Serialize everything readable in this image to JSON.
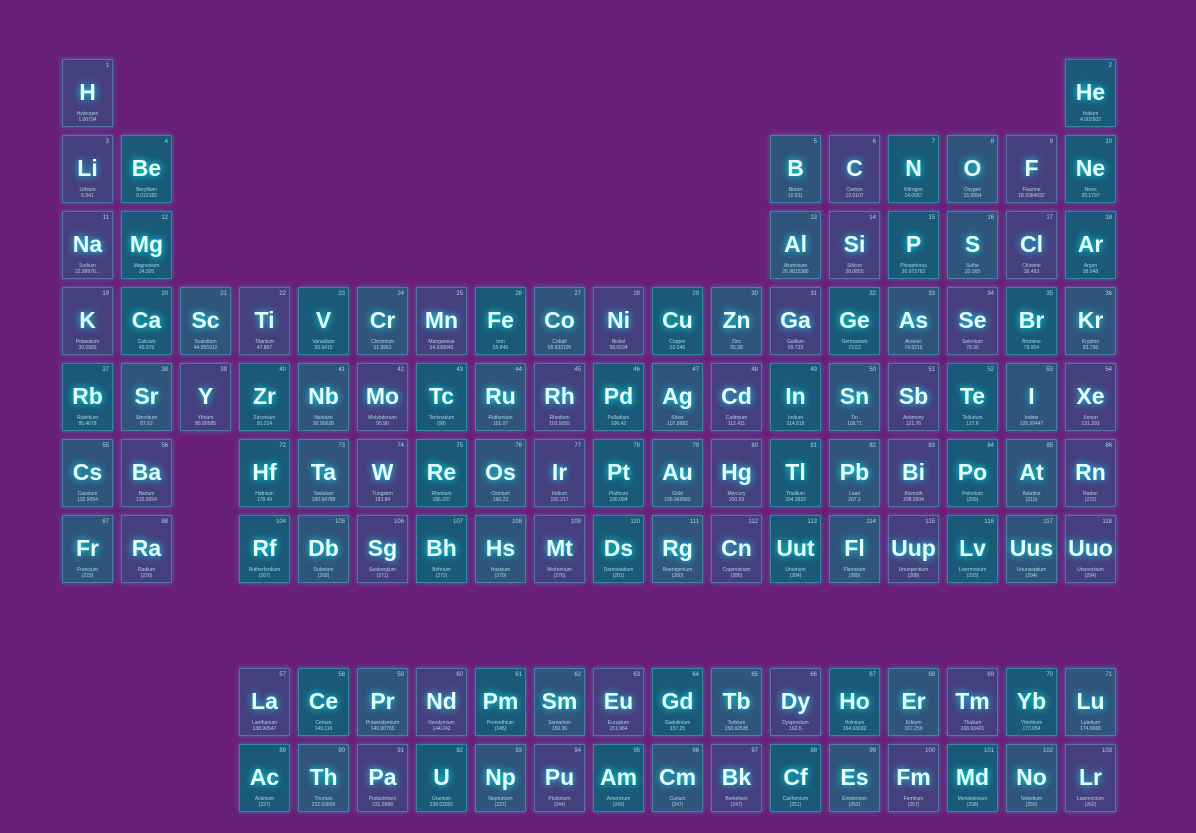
{
  "elements": [
    {
      "number": "1",
      "symbol": "H",
      "name": "Hydrogen",
      "mass": "1.00794",
      "col": 1,
      "row": 1
    },
    {
      "number": "2",
      "symbol": "He",
      "name": "Helium",
      "mass": "4.002602",
      "col": 18,
      "row": 1
    },
    {
      "number": "3",
      "symbol": "Li",
      "name": "Lithium",
      "mass": "6.941",
      "col": 1,
      "row": 2
    },
    {
      "number": "4",
      "symbol": "Be",
      "name": "Beryllium",
      "mass": "9.012182",
      "col": 2,
      "row": 2
    },
    {
      "number": "5",
      "symbol": "B",
      "name": "Boron",
      "mass": "10.811",
      "col": 13,
      "row": 2
    },
    {
      "number": "6",
      "symbol": "C",
      "name": "Carbon",
      "mass": "12.0107",
      "col": 14,
      "row": 2
    },
    {
      "number": "7",
      "symbol": "N",
      "name": "Nitrogen",
      "mass": "14.0067",
      "col": 15,
      "row": 2
    },
    {
      "number": "8",
      "symbol": "O",
      "name": "Oxygen",
      "mass": "15.9994",
      "col": 16,
      "row": 2
    },
    {
      "number": "9",
      "symbol": "F",
      "name": "Fluorine",
      "mass": "18.9984032",
      "col": 17,
      "row": 2
    },
    {
      "number": "10",
      "symbol": "Ne",
      "name": "Neon",
      "mass": "20.1797",
      "col": 18,
      "row": 2
    },
    {
      "number": "11",
      "symbol": "Na",
      "name": "Sodium",
      "mass": "22.98976...",
      "col": 1,
      "row": 3
    },
    {
      "number": "12",
      "symbol": "Mg",
      "name": "Magnesium",
      "mass": "24.305",
      "col": 2,
      "row": 3
    },
    {
      "number": "13",
      "symbol": "Al",
      "name": "Aluminium",
      "mass": "26.9815386",
      "col": 13,
      "row": 3
    },
    {
      "number": "14",
      "symbol": "Si",
      "name": "Silicon",
      "mass": "28.0855",
      "col": 14,
      "row": 3
    },
    {
      "number": "15",
      "symbol": "P",
      "name": "Phosphorus",
      "mass": "30.973762",
      "col": 15,
      "row": 3
    },
    {
      "number": "16",
      "symbol": "S",
      "name": "Sulfur",
      "mass": "32.065",
      "col": 16,
      "row": 3
    },
    {
      "number": "17",
      "symbol": "Cl",
      "name": "Chlorine",
      "mass": "35.453",
      "col": 17,
      "row": 3
    },
    {
      "number": "18",
      "symbol": "Ar",
      "name": "Argon",
      "mass": "39.948",
      "col": 18,
      "row": 3
    },
    {
      "number": "19",
      "symbol": "K",
      "name": "Potassium",
      "mass": "39.0983",
      "col": 1,
      "row": 4
    },
    {
      "number": "20",
      "symbol": "Ca",
      "name": "Calcium",
      "mass": "40.078",
      "col": 2,
      "row": 4
    },
    {
      "number": "21",
      "symbol": "Sc",
      "name": "Scandium",
      "mass": "44.955912",
      "col": 3,
      "row": 4
    },
    {
      "number": "22",
      "symbol": "Ti",
      "name": "Titanium",
      "mass": "47.867",
      "col": 4,
      "row": 4
    },
    {
      "number": "23",
      "symbol": "V",
      "name": "Vanadium",
      "mass": "50.9415",
      "col": 5,
      "row": 4
    },
    {
      "number": "24",
      "symbol": "Cr",
      "name": "Chromium",
      "mass": "51.9961",
      "col": 6,
      "row": 4
    },
    {
      "number": "25",
      "symbol": "Mn",
      "name": "Manganese",
      "mass": "54.938045",
      "col": 7,
      "row": 4
    },
    {
      "number": "26",
      "symbol": "Fe",
      "name": "Iron",
      "mass": "55.845",
      "col": 8,
      "row": 4
    },
    {
      "number": "27",
      "symbol": "Co",
      "name": "Cobalt",
      "mass": "58.933195",
      "col": 9,
      "row": 4
    },
    {
      "number": "28",
      "symbol": "Ni",
      "name": "Nickel",
      "mass": "58.6934",
      "col": 10,
      "row": 4
    },
    {
      "number": "29",
      "symbol": "Cu",
      "name": "Copper",
      "mass": "63.546",
      "col": 11,
      "row": 4
    },
    {
      "number": "30",
      "symbol": "Zn",
      "name": "Zinc",
      "mass": "65.38",
      "col": 12,
      "row": 4
    },
    {
      "number": "31",
      "symbol": "Ga",
      "name": "Gallium",
      "mass": "69.723",
      "col": 13,
      "row": 4
    },
    {
      "number": "32",
      "symbol": "Ge",
      "name": "Germanium",
      "mass": "72.63",
      "col": 14,
      "row": 4
    },
    {
      "number": "33",
      "symbol": "As",
      "name": "Arsenic",
      "mass": "74.9216",
      "col": 15,
      "row": 4
    },
    {
      "number": "34",
      "symbol": "Se",
      "name": "Selenium",
      "mass": "78.96",
      "col": 16,
      "row": 4
    },
    {
      "number": "35",
      "symbol": "Br",
      "name": "Bromine",
      "mass": "79.904",
      "col": 17,
      "row": 4
    },
    {
      "number": "36",
      "symbol": "Kr",
      "name": "Krypton",
      "mass": "83.798",
      "col": 18,
      "row": 4
    },
    {
      "number": "37",
      "symbol": "Rb",
      "name": "Rubidium",
      "mass": "85.4678",
      "col": 1,
      "row": 5
    },
    {
      "number": "38",
      "symbol": "Sr",
      "name": "Strontium",
      "mass": "87.62",
      "col": 2,
      "row": 5
    },
    {
      "number": "39",
      "symbol": "Y",
      "name": "Yttrium",
      "mass": "88.90585",
      "col": 3,
      "row": 5
    },
    {
      "number": "40",
      "symbol": "Zr",
      "name": "Zirconium",
      "mass": "91.224",
      "col": 4,
      "row": 5
    },
    {
      "number": "41",
      "symbol": "Nb",
      "name": "Niobium",
      "mass": "92.90628",
      "col": 5,
      "row": 5
    },
    {
      "number": "42",
      "symbol": "Mo",
      "name": "Molybdenum",
      "mass": "95.96",
      "col": 6,
      "row": 5
    },
    {
      "number": "43",
      "symbol": "Tc",
      "name": "Technetium",
      "mass": "(98)",
      "col": 7,
      "row": 5
    },
    {
      "number": "44",
      "symbol": "Ru",
      "name": "Ruthenium",
      "mass": "101.07",
      "col": 8,
      "row": 5
    },
    {
      "number": "45",
      "symbol": "Rh",
      "name": "Rhodium",
      "mass": "102.9055",
      "col": 9,
      "row": 5
    },
    {
      "number": "46",
      "symbol": "Pd",
      "name": "Palladium",
      "mass": "106.42",
      "col": 10,
      "row": 5
    },
    {
      "number": "47",
      "symbol": "Ag",
      "name": "Silver",
      "mass": "107.8682",
      "col": 11,
      "row": 5
    },
    {
      "number": "48",
      "symbol": "Cd",
      "name": "Cadmium",
      "mass": "112.411",
      "col": 12,
      "row": 5
    },
    {
      "number": "49",
      "symbol": "In",
      "name": "Indium",
      "mass": "114.818",
      "col": 13,
      "row": 5
    },
    {
      "number": "50",
      "symbol": "Sn",
      "name": "Tin",
      "mass": "118.71",
      "col": 14,
      "row": 5
    },
    {
      "number": "51",
      "symbol": "Sb",
      "name": "Antimony",
      "mass": "121.76",
      "col": 15,
      "row": 5
    },
    {
      "number": "52",
      "symbol": "Te",
      "name": "Tellurium",
      "mass": "127.6",
      "col": 16,
      "row": 5
    },
    {
      "number": "53",
      "symbol": "I",
      "name": "Iodine",
      "mass": "126.90447",
      "col": 17,
      "row": 5
    },
    {
      "number": "54",
      "symbol": "Xe",
      "name": "Xenon",
      "mass": "131.293",
      "col": 18,
      "row": 5
    },
    {
      "number": "55",
      "symbol": "Cs",
      "name": "Caesium",
      "mass": "132.9054",
      "col": 1,
      "row": 6
    },
    {
      "number": "56",
      "symbol": "Ba",
      "name": "Barium",
      "mass": "132.9054",
      "col": 2,
      "row": 6
    },
    {
      "number": "72",
      "symbol": "Hf",
      "name": "Hafnium",
      "mass": "178.49",
      "col": 4,
      "row": 6
    },
    {
      "number": "73",
      "symbol": "Ta",
      "name": "Tantalum",
      "mass": "180.94788",
      "col": 5,
      "row": 6
    },
    {
      "number": "74",
      "symbol": "W",
      "name": "Tungsten",
      "mass": "183.84",
      "col": 6,
      "row": 6
    },
    {
      "number": "75",
      "symbol": "Re",
      "name": "Rhenium",
      "mass": "186.207",
      "col": 7,
      "row": 6
    },
    {
      "number": "76",
      "symbol": "Os",
      "name": "Osmium",
      "mass": "190.23",
      "col": 8,
      "row": 6
    },
    {
      "number": "77",
      "symbol": "Ir",
      "name": "Iridium",
      "mass": "192.217",
      "col": 9,
      "row": 6
    },
    {
      "number": "78",
      "symbol": "Pt",
      "name": "Platinum",
      "mass": "195.084",
      "col": 10,
      "row": 6
    },
    {
      "number": "79",
      "symbol": "Au",
      "name": "Gold",
      "mass": "196.966569",
      "col": 11,
      "row": 6
    },
    {
      "number": "80",
      "symbol": "Hg",
      "name": "Mercury",
      "mass": "200.59",
      "col": 12,
      "row": 6
    },
    {
      "number": "81",
      "symbol": "Tl",
      "name": "Thallium",
      "mass": "204.3833",
      "col": 13,
      "row": 6
    },
    {
      "number": "82",
      "symbol": "Pb",
      "name": "Lead",
      "mass": "207.2",
      "col": 14,
      "row": 6
    },
    {
      "number": "83",
      "symbol": "Bi",
      "name": "Bismuth",
      "mass": "208.9804",
      "col": 15,
      "row": 6
    },
    {
      "number": "84",
      "symbol": "Po",
      "name": "Polonium",
      "mass": "(209)",
      "col": 16,
      "row": 6
    },
    {
      "number": "85",
      "symbol": "At",
      "name": "Astatine",
      "mass": "(210)",
      "col": 17,
      "row": 6
    },
    {
      "number": "86",
      "symbol": "Rn",
      "name": "Radon",
      "mass": "(222)",
      "col": 18,
      "row": 6
    },
    {
      "number": "87",
      "symbol": "Fr",
      "name": "Francium",
      "mass": "(223)",
      "col": 1,
      "row": 7
    },
    {
      "number": "88",
      "symbol": "Ra",
      "name": "Radium",
      "mass": "(226)",
      "col": 2,
      "row": 7
    },
    {
      "number": "104",
      "symbol": "Rf",
      "name": "Rutherfordium",
      "mass": "(267)",
      "col": 4,
      "row": 7
    },
    {
      "number": "105",
      "symbol": "Db",
      "name": "Dubnium",
      "mass": "(268)",
      "col": 5,
      "row": 7
    },
    {
      "number": "106",
      "symbol": "Sg",
      "name": "Seaborgium",
      "mass": "(271)",
      "col": 6,
      "row": 7
    },
    {
      "number": "107",
      "symbol": "Bh",
      "name": "Bohrium",
      "mass": "(272)",
      "col": 7,
      "row": 7
    },
    {
      "number": "108",
      "symbol": "Hs",
      "name": "Hassium",
      "mass": "(270)",
      "col": 8,
      "row": 7
    },
    {
      "number": "109",
      "symbol": "Mt",
      "name": "Meitnerium",
      "mass": "(276)",
      "col": 9,
      "row": 7
    },
    {
      "number": "110",
      "symbol": "Ds",
      "name": "Darmstadium",
      "mass": "(281)",
      "col": 10,
      "row": 7
    },
    {
      "number": "111",
      "symbol": "Rg",
      "name": "Roentgenium",
      "mass": "(280)",
      "col": 11,
      "row": 7
    },
    {
      "number": "112",
      "symbol": "Cn",
      "name": "Copernicium",
      "mass": "(285)",
      "col": 12,
      "row": 7
    },
    {
      "number": "113",
      "symbol": "Uut",
      "name": "Unutrium",
      "mass": "(284)",
      "col": 13,
      "row": 7
    },
    {
      "number": "114",
      "symbol": "Fl",
      "name": "Flerovium",
      "mass": "(289)",
      "col": 14,
      "row": 7
    },
    {
      "number": "115",
      "symbol": "Uup",
      "name": "Ununpentium",
      "mass": "(288)",
      "col": 15,
      "row": 7
    },
    {
      "number": "116",
      "symbol": "Lv",
      "name": "Livermorium",
      "mass": "(293)",
      "col": 16,
      "row": 7
    },
    {
      "number": "117",
      "symbol": "Uus",
      "name": "Ununseptium",
      "mass": "(294)",
      "col": 17,
      "row": 7
    },
    {
      "number": "118",
      "symbol": "Uuo",
      "name": "Ununoctium",
      "mass": "(294)",
      "col": 18,
      "row": 7
    },
    {
      "number": "57",
      "symbol": "La",
      "name": "Lanthanum",
      "mass": "138.90547",
      "col": 4,
      "row": 9
    },
    {
      "number": "58",
      "symbol": "Ce",
      "name": "Cerium",
      "mass": "140.116",
      "col": 5,
      "row": 9
    },
    {
      "number": "59",
      "symbol": "Pr",
      "name": "Praseodymium",
      "mass": "140.90765",
      "col": 6,
      "row": 9
    },
    {
      "number": "60",
      "symbol": "Nd",
      "name": "Neodymium",
      "mass": "144.242",
      "col": 7,
      "row": 9
    },
    {
      "number": "61",
      "symbol": "Pm",
      "name": "Promethium",
      "mass": "(145)",
      "col": 8,
      "row": 9
    },
    {
      "number": "62",
      "symbol": "Sm",
      "name": "Samarium",
      "mass": "150.36",
      "col": 9,
      "row": 9
    },
    {
      "number": "63",
      "symbol": "Eu",
      "name": "Europium",
      "mass": "151.964",
      "col": 10,
      "row": 9
    },
    {
      "number": "64",
      "symbol": "Gd",
      "name": "Gadolinium",
      "mass": "157.25",
      "col": 11,
      "row": 9
    },
    {
      "number": "65",
      "symbol": "Tb",
      "name": "Terbium",
      "mass": "158.92535",
      "col": 12,
      "row": 9
    },
    {
      "number": "66",
      "symbol": "Dy",
      "name": "Dysprosium",
      "mass": "162.5",
      "col": 13,
      "row": 9
    },
    {
      "number": "67",
      "symbol": "Ho",
      "name": "Holmium",
      "mass": "164.93032",
      "col": 14,
      "row": 9
    },
    {
      "number": "68",
      "symbol": "Er",
      "name": "Erbium",
      "mass": "167.259",
      "col": 15,
      "row": 9
    },
    {
      "number": "69",
      "symbol": "Tm",
      "name": "Thulium",
      "mass": "168.93421",
      "col": 16,
      "row": 9
    },
    {
      "number": "70",
      "symbol": "Yb",
      "name": "Ytterbium",
      "mass": "173.054",
      "col": 17,
      "row": 9
    },
    {
      "number": "71",
      "symbol": "Lu",
      "name": "Lutetium",
      "mass": "174.9668",
      "col": 18,
      "row": 9
    },
    {
      "number": "89",
      "symbol": "Ac",
      "name": "Actinium",
      "mass": "(227)",
      "col": 4,
      "row": 10
    },
    {
      "number": "90",
      "symbol": "Th",
      "name": "Thorium",
      "mass": "232.03806",
      "col": 5,
      "row": 10
    },
    {
      "number": "91",
      "symbol": "Pa",
      "name": "Protactinium",
      "mass": "231.0588",
      "col": 6,
      "row": 10
    },
    {
      "number": "92",
      "symbol": "U",
      "name": "Uranium",
      "mass": "238.02891",
      "col": 7,
      "row": 10
    },
    {
      "number": "93",
      "symbol": "Np",
      "name": "Neptunium",
      "mass": "(237)",
      "col": 8,
      "row": 10
    },
    {
      "number": "94",
      "symbol": "Pu",
      "name": "Plutonium",
      "mass": "(244)",
      "col": 9,
      "row": 10
    },
    {
      "number": "95",
      "symbol": "Am",
      "name": "Americium",
      "mass": "(243)",
      "col": 10,
      "row": 10
    },
    {
      "number": "96",
      "symbol": "Cm",
      "name": "Curium",
      "mass": "(247)",
      "col": 11,
      "row": 10
    },
    {
      "number": "97",
      "symbol": "Bk",
      "name": "Berkelium",
      "mass": "(247)",
      "col": 12,
      "row": 10
    },
    {
      "number": "98",
      "symbol": "Cf",
      "name": "Californium",
      "mass": "(251)",
      "col": 13,
      "row": 10
    },
    {
      "number": "99",
      "symbol": "Es",
      "name": "Einstenium",
      "mass": "(252)",
      "col": 14,
      "row": 10
    },
    {
      "number": "100",
      "symbol": "Fm",
      "name": "Fermium",
      "mass": "(257)",
      "col": 15,
      "row": 10
    },
    {
      "number": "101",
      "symbol": "Md",
      "name": "Mendelevium",
      "mass": "(258)",
      "col": 16,
      "row": 10
    },
    {
      "number": "102",
      "symbol": "No",
      "name": "Nobelium",
      "mass": "(259)",
      "col": 17,
      "row": 10
    },
    {
      "number": "103",
      "symbol": "Lr",
      "name": "Lawrencium",
      "mass": "(262)",
      "col": 18,
      "row": 10
    }
  ],
  "colors": {
    "background": "#6a1f78",
    "tile_teal": "#0f6f7b",
    "tile_slate": "#3a4f80",
    "glow": "#00ffff"
  }
}
